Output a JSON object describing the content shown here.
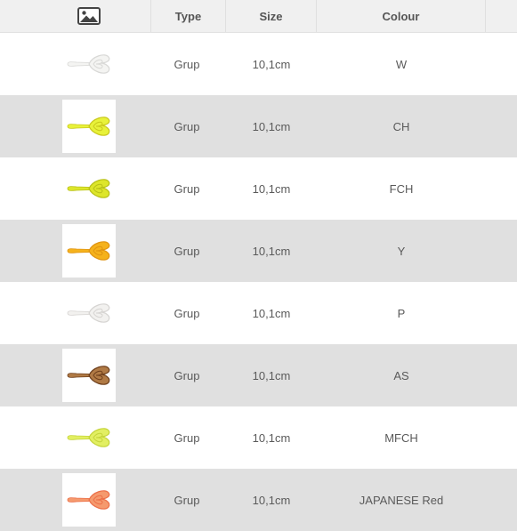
{
  "header": {
    "image_icon": "image-icon",
    "type_label": "Type",
    "size_label": "Size",
    "colour_label": "Colour"
  },
  "rows": [
    {
      "type": "Grup",
      "size": "10,1cm",
      "colour": "W",
      "lure_color": "#f4f4f2",
      "lure_edge": "#d8d8d6"
    },
    {
      "type": "Grup",
      "size": "10,1cm",
      "colour": "CH",
      "lure_color": "#e8f23a",
      "lure_edge": "#c9c81c"
    },
    {
      "type": "Grup",
      "size": "10,1cm",
      "colour": "FCH",
      "lure_color": "#dde62a",
      "lure_edge": "#b8c018"
    },
    {
      "type": "Grup",
      "size": "10,1cm",
      "colour": "Y",
      "lure_color": "#f5b21c",
      "lure_edge": "#e09412"
    },
    {
      "type": "Grup",
      "size": "10,1cm",
      "colour": "P",
      "lure_color": "#f2f1ef",
      "lure_edge": "#d6d4d2"
    },
    {
      "type": "Grup",
      "size": "10,1cm",
      "colour": "AS",
      "lure_color": "#b07a45",
      "lure_edge": "#6e3f1c"
    },
    {
      "type": "Grup",
      "size": "10,1cm",
      "colour": "MFCH",
      "lure_color": "#e2ef62",
      "lure_edge": "#c5d43a"
    },
    {
      "type": "Grup",
      "size": "10,1cm",
      "colour": "JAPANESE Red",
      "lure_color": "#f59a6e",
      "lure_edge": "#ec6f48"
    }
  ]
}
